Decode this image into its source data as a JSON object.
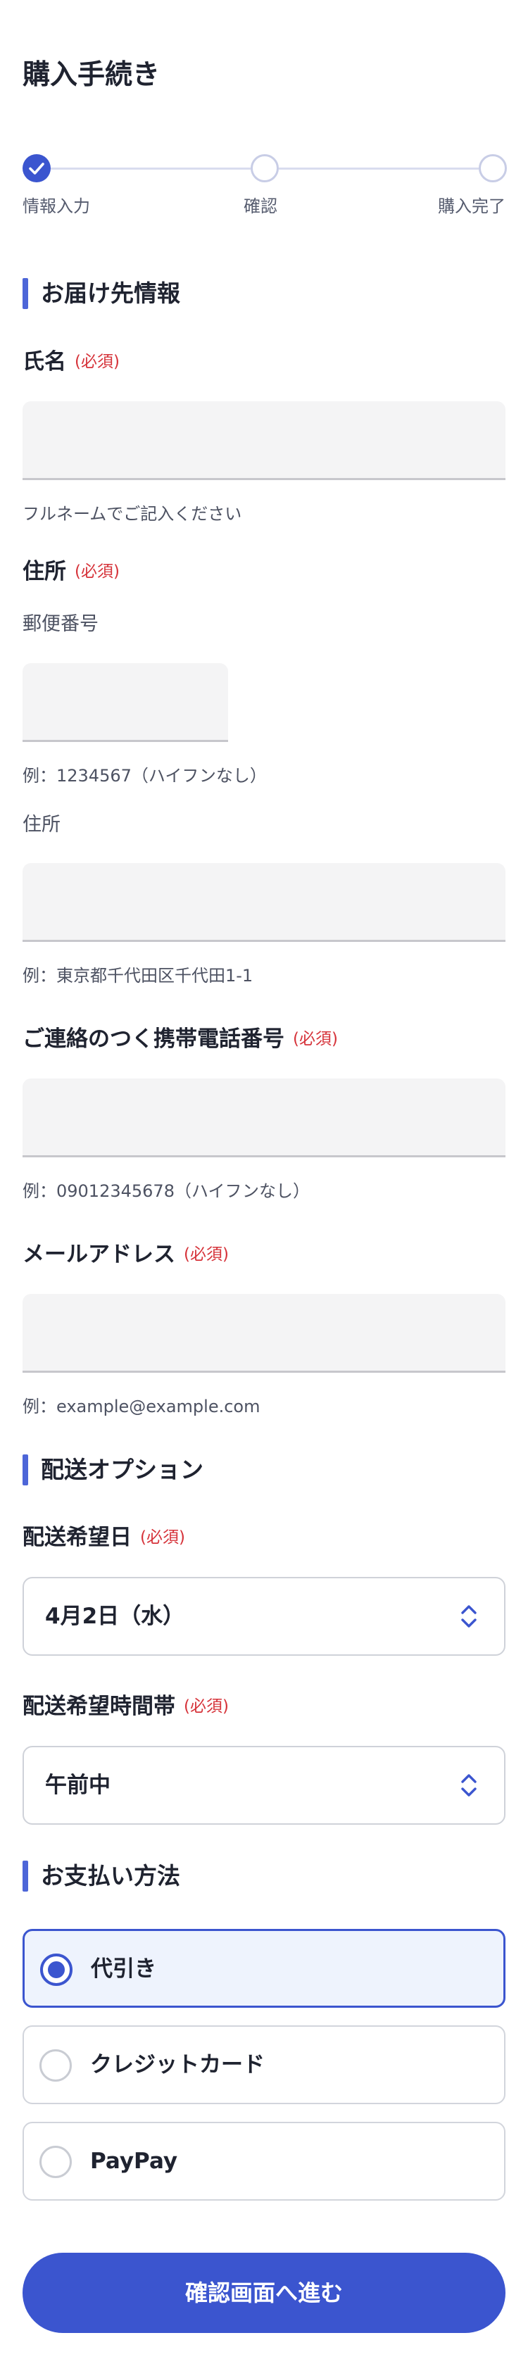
{
  "page": {
    "title": "購入手続き"
  },
  "stepper": {
    "steps": [
      {
        "label": "情報入力",
        "state": "done"
      },
      {
        "label": "確認",
        "state": "todo"
      },
      {
        "label": "購入完了",
        "state": "todo"
      }
    ],
    "colors": {
      "done": "#3b55cf",
      "todo": "#c8cde6"
    }
  },
  "required_label": "(必須)",
  "sections": {
    "delivery": "お届け先情報",
    "shipping": "配送オプション",
    "payment": "お支払い方法"
  },
  "name_field": {
    "label": "氏名",
    "value": "",
    "hint": "フルネームでご記入ください"
  },
  "address": {
    "label": "住所",
    "postal_label": "郵便番号",
    "postal_value": "",
    "postal_hint": "例：1234567（ハイフンなし）",
    "address_label": "住所",
    "address_value": "",
    "address_hint": "例：東京都千代田区千代田1-1"
  },
  "phone_field": {
    "label": "ご連絡のつく携帯電話番号",
    "value": "",
    "hint": "例：09012345678（ハイフンなし）"
  },
  "email_field": {
    "label": "メールアドレス",
    "value": "",
    "hint": "例：example@example.com"
  },
  "delivery_date": {
    "label": "配送希望日",
    "selected": "4月2日（水）"
  },
  "delivery_time": {
    "label": "配送希望時間帯",
    "selected": "午前中"
  },
  "payment": {
    "options": [
      {
        "label": "代引き",
        "selected": true
      },
      {
        "label": "クレジットカード",
        "selected": false
      },
      {
        "label": "PayPay",
        "selected": false
      }
    ]
  },
  "submit_label": "確認画面へ進む",
  "accent_color": "#3b55cf",
  "required_color": "#d6333a"
}
